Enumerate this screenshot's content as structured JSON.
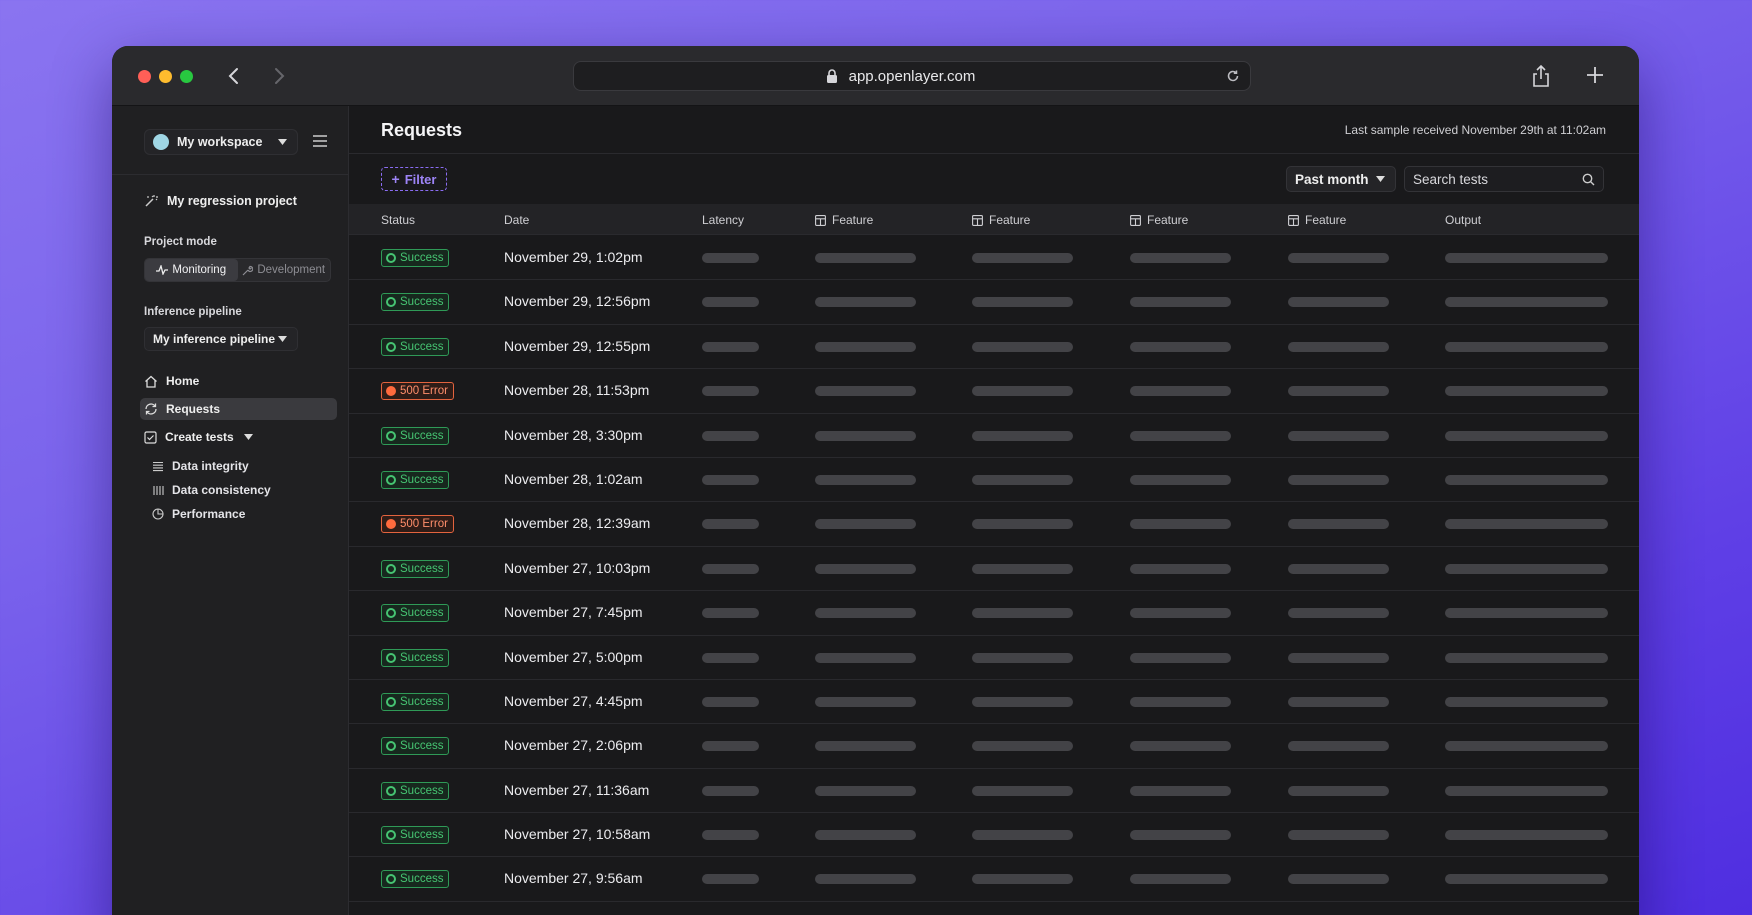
{
  "browser": {
    "url": "app.openlayer.com"
  },
  "sidebar": {
    "workspace": "My workspace",
    "project": "My regression project",
    "project_mode_label": "Project mode",
    "modes": {
      "monitoring": "Monitoring",
      "development": "Development"
    },
    "pipeline_label": "Inference pipeline",
    "pipeline": "My inference pipeline",
    "nav": {
      "home": "Home",
      "requests": "Requests",
      "create_tests": "Create tests"
    },
    "sub": {
      "integrity": "Data integrity",
      "consistency": "Data consistency",
      "performance": "Performance"
    }
  },
  "main": {
    "title": "Requests",
    "last_sample": "Last sample received November 29th at 11:02am",
    "filter": "Filter",
    "period": "Past month",
    "search_placeholder": "Search tests",
    "columns": {
      "status": "Status",
      "date": "Date",
      "latency": "Latency",
      "feature": "Feature",
      "output": "Output"
    },
    "rows": [
      {
        "status": "Success",
        "date": "November 29, 1:02pm"
      },
      {
        "status": "Success",
        "date": "November 29, 12:56pm"
      },
      {
        "status": "Success",
        "date": "November 29, 12:55pm"
      },
      {
        "status": "500 Error",
        "date": "November 28, 11:53pm"
      },
      {
        "status": "Success",
        "date": "November 28, 3:30pm"
      },
      {
        "status": "Success",
        "date": "November 28, 1:02am"
      },
      {
        "status": "500 Error",
        "date": "November 28, 12:39am"
      },
      {
        "status": "Success",
        "date": "November 27, 10:03pm"
      },
      {
        "status": "Success",
        "date": "November 27, 7:45pm"
      },
      {
        "status": "Success",
        "date": "November 27, 5:00pm"
      },
      {
        "status": "Success",
        "date": "November 27, 4:45pm"
      },
      {
        "status": "Success",
        "date": "November 27, 2:06pm"
      },
      {
        "status": "Success",
        "date": "November 27, 11:36am"
      },
      {
        "status": "Success",
        "date": "November 27, 10:58am"
      },
      {
        "status": "Success",
        "date": "November 27, 9:56am"
      }
    ]
  },
  "colors": {
    "accent": "#8a6cf2",
    "success": "#46c472",
    "error": "#ff6a3d"
  }
}
